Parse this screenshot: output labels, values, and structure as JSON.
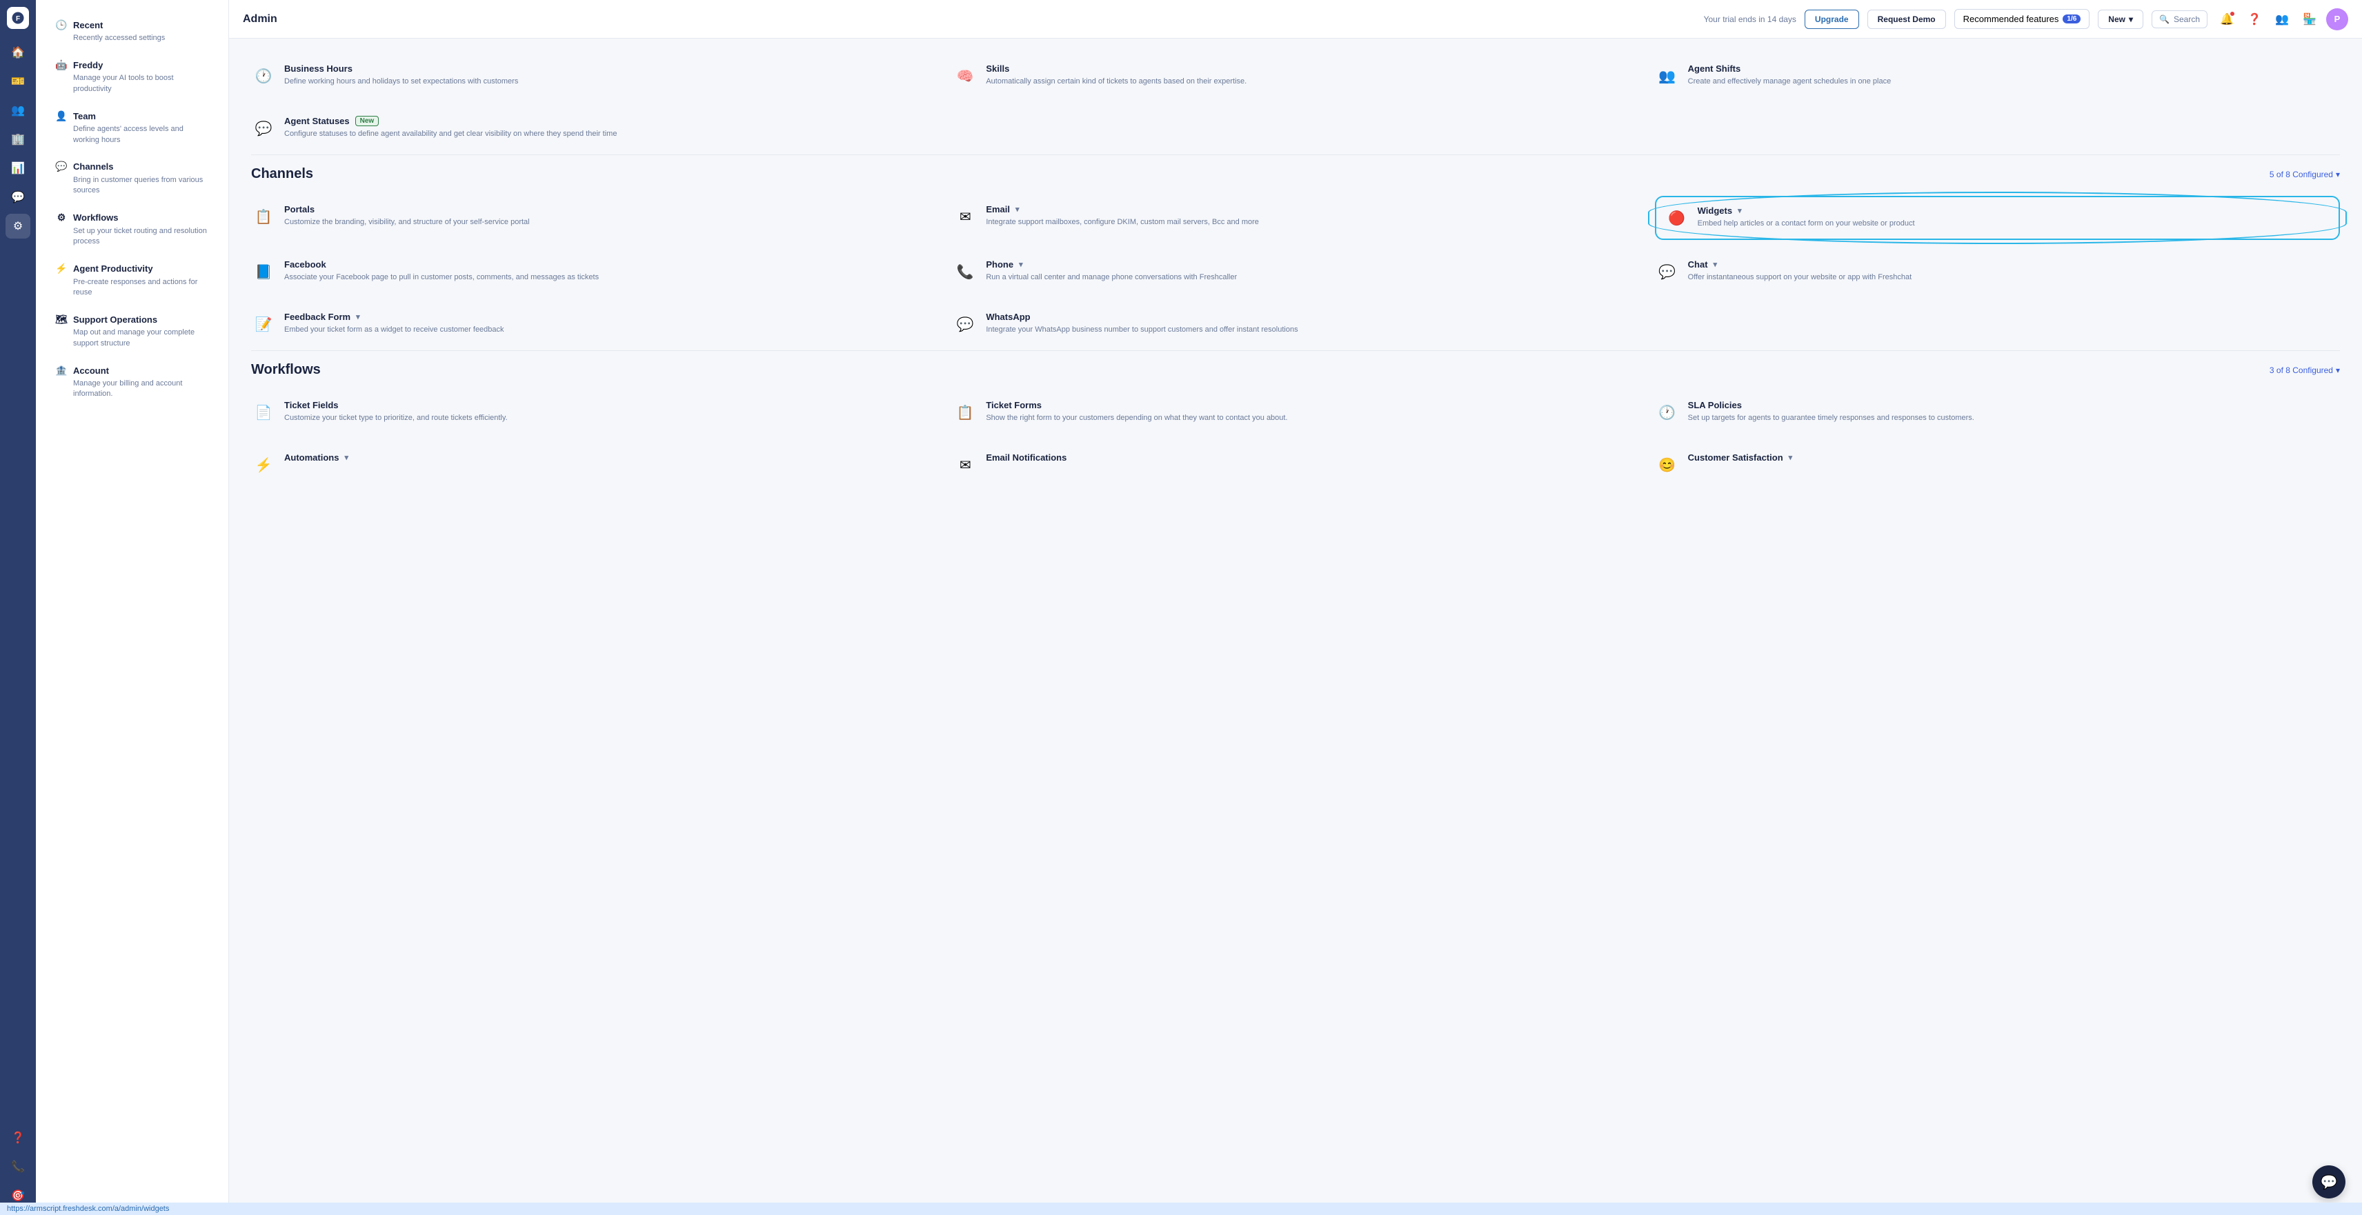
{
  "app": {
    "title": "Admin"
  },
  "topbar": {
    "trial_text": "Your trial ends in 14 days",
    "upgrade_label": "Upgrade",
    "request_demo_label": "Request Demo",
    "recommended_features_label": "Recommended features",
    "recommended_badge": "1/6",
    "new_label": "New",
    "search_label": "Search"
  },
  "sidebar": {
    "items": [
      {
        "id": "recent",
        "icon": "🕒",
        "title": "Recent",
        "desc": "Recently accessed settings"
      },
      {
        "id": "freddy",
        "icon": "🤖",
        "title": "Freddy",
        "desc": "Manage your AI tools to boost productivity"
      },
      {
        "id": "team",
        "icon": "👤",
        "title": "Team",
        "desc": "Define agents' access levels and working hours"
      },
      {
        "id": "channels",
        "icon": "💬",
        "title": "Channels",
        "desc": "Bring in customer queries from various sources"
      },
      {
        "id": "workflows",
        "icon": "⚙",
        "title": "Workflows",
        "desc": "Set up your ticket routing and resolution process"
      },
      {
        "id": "agent-productivity",
        "icon": "⚡",
        "title": "Agent Productivity",
        "desc": "Pre-create responses and actions for reuse"
      },
      {
        "id": "support-operations",
        "icon": "🗺",
        "title": "Support Operations",
        "desc": "Map out and manage your complete support structure"
      },
      {
        "id": "account",
        "icon": "🏦",
        "title": "Account",
        "desc": "Manage your billing and account information."
      }
    ]
  },
  "team_section": {
    "features": [
      {
        "id": "business-hours",
        "icon": "🕐",
        "name": "Business Hours",
        "desc": "Define working hours and holidays to set expectations with customers"
      },
      {
        "id": "skills",
        "icon": "🧠",
        "name": "Skills",
        "desc": "Automatically assign certain kind of tickets to agents based on their expertise."
      },
      {
        "id": "agent-shifts",
        "icon": "👥",
        "name": "Agent Shifts",
        "desc": "Create and effectively manage agent schedules in one place"
      },
      {
        "id": "agent-statuses",
        "icon": "💬",
        "name": "Agent Statuses",
        "is_new": true,
        "desc": "Configure statuses to define agent availability and get clear visibility on where they spend their time"
      }
    ]
  },
  "channels": {
    "title": "Channels",
    "config_text": "5 of 8 Configured",
    "features": [
      {
        "id": "portals",
        "icon": "📋",
        "name": "Portals",
        "desc": "Customize the branding, visibility, and structure of your self-service portal"
      },
      {
        "id": "email",
        "icon": "✉",
        "name": "Email",
        "has_chevron": true,
        "desc": "Integrate support mailboxes, configure DKIM, custom mail servers, Bcc and more"
      },
      {
        "id": "widgets",
        "icon": "🔴",
        "name": "Widgets",
        "has_chevron": true,
        "highlighted": true,
        "desc": "Embed help articles or a contact form on your website or product"
      },
      {
        "id": "facebook",
        "icon": "📘",
        "name": "Facebook",
        "desc": "Associate your Facebook page to pull in customer posts, comments, and messages as tickets"
      },
      {
        "id": "phone",
        "icon": "📞",
        "name": "Phone",
        "has_chevron": true,
        "desc": "Run a virtual call center and manage phone conversations with Freshcaller"
      },
      {
        "id": "chat",
        "icon": "💬",
        "name": "Chat",
        "has_chevron": true,
        "desc": "Offer instantaneous support on your website or app with Freshchat"
      },
      {
        "id": "feedback-form",
        "icon": "📝",
        "name": "Feedback Form",
        "has_chevron": true,
        "desc": "Embed your ticket form as a widget to receive customer feedback"
      },
      {
        "id": "whatsapp",
        "icon": "💬",
        "name": "WhatsApp",
        "desc": "Integrate your WhatsApp business number to support customers and offer instant resolutions"
      }
    ]
  },
  "workflows": {
    "title": "Workflows",
    "config_text": "3 of 8 Configured",
    "features": [
      {
        "id": "ticket-fields",
        "icon": "📄",
        "name": "Ticket Fields",
        "desc": "Customize your ticket type to prioritize, and route tickets efficiently."
      },
      {
        "id": "ticket-forms",
        "icon": "📋",
        "name": "Ticket Forms",
        "desc": "Show the right form to your customers depending on what they want to contact you about."
      },
      {
        "id": "sla-policies",
        "icon": "🕐",
        "name": "SLA Policies",
        "desc": "Set up targets for agents to guarantee timely responses and responses to customers."
      },
      {
        "id": "automations",
        "icon": "⚡",
        "name": "Automations",
        "has_chevron": true,
        "desc": ""
      },
      {
        "id": "email-notifications",
        "icon": "✉",
        "name": "Email Notifications",
        "desc": ""
      },
      {
        "id": "customer-satisfaction",
        "icon": "😊",
        "name": "Customer Satisfaction",
        "has_chevron": true,
        "desc": ""
      }
    ]
  },
  "status_bar": {
    "url": "https://armscript.freshdesk.com/a/admin/widgets"
  },
  "avatar": {
    "initial": "P"
  }
}
